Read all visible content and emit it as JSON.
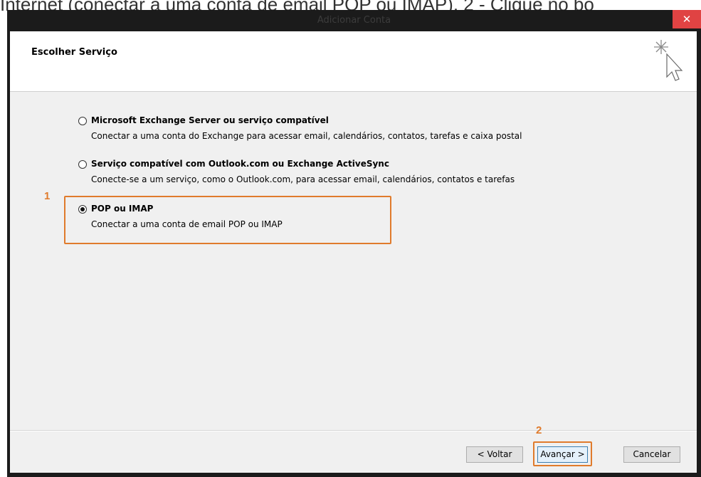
{
  "article": {
    "text": "Internet (conectar a uma conta de email POP ou IMAP). 2 - Clique no bo"
  },
  "window": {
    "title": "Adicionar Conta",
    "close_glyph": "✕"
  },
  "header": {
    "title": "Escolher Serviço",
    "icon": "cursor-sparkle-icon"
  },
  "options": [
    {
      "label": "Microsoft Exchange Server ou serviço compatível",
      "description": "Conectar a uma conta do Exchange para acessar email, calendários, contatos, tarefas e caixa postal",
      "selected": false
    },
    {
      "label": "Serviço compatível com Outlook.com ou Exchange ActiveSync",
      "description": "Conecte-se a um serviço, como o Outlook.com, para acessar email, calendários, contatos e tarefas",
      "selected": false
    },
    {
      "label": "POP ou IMAP",
      "description": "Conectar a uma conta de email POP ou IMAP",
      "selected": true
    }
  ],
  "annotations": {
    "step1": "1",
    "step2": "2",
    "color": "#e07b2c"
  },
  "buttons": {
    "back": "< Voltar",
    "next": "Avançar >",
    "cancel": "Cancelar"
  },
  "colors": {
    "titlebar": "#1b1b1b",
    "close": "#e04343",
    "dialog_bg": "#f0f0f0"
  }
}
